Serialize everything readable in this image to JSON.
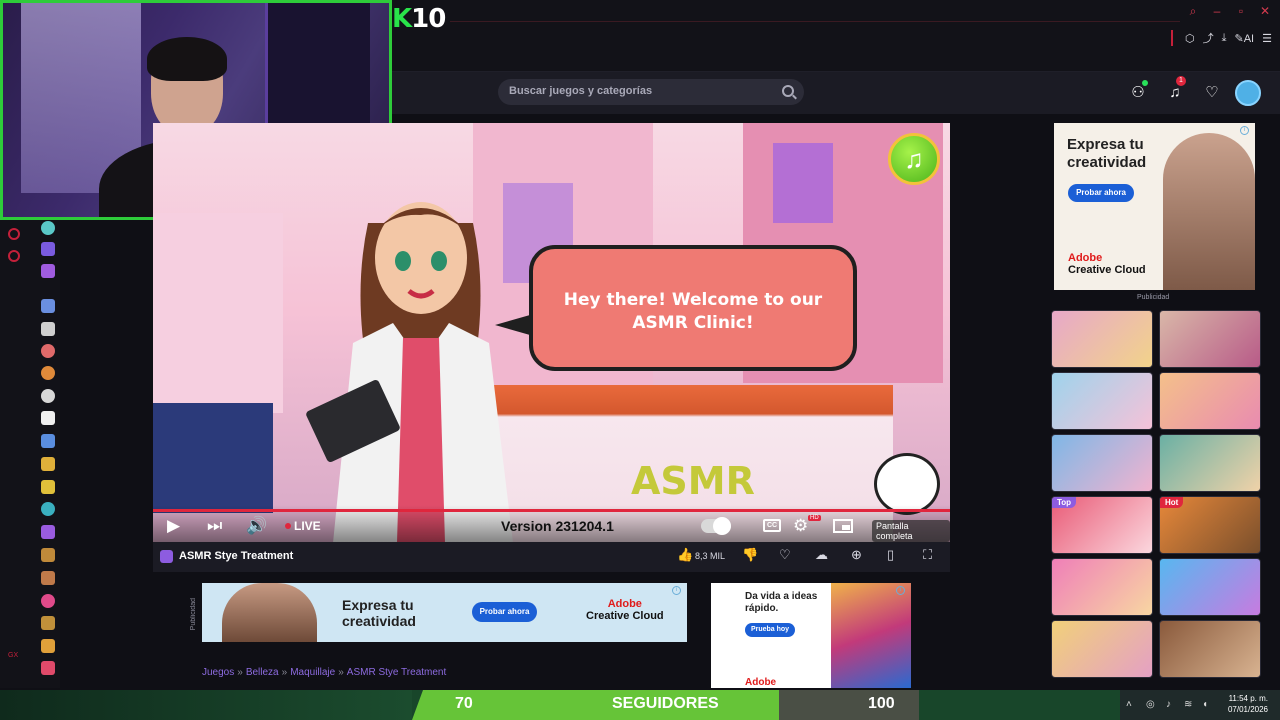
{
  "stream_overlay": {
    "logo_k": "K",
    "logo_num": "10"
  },
  "search": {
    "placeholder": "Buscar juegos y categorías"
  },
  "header": {
    "notifications_count": "1"
  },
  "game": {
    "speech_text": "Hey there! Welcome to our ASMR Clinic!",
    "title_logo": "ASMR",
    "live_label": "LIVE",
    "version": "Version 231204.1",
    "fullscreen_tooltip": "Pantalla completa",
    "name": "ASMR Stye Treatment",
    "likes": "8,3 MIL",
    "cc_label": "CC",
    "hd_label": "HD"
  },
  "ad_top": {
    "headline": "Expresa tu creatividad",
    "button": "Probar ahora",
    "brand_line1": "Adobe",
    "brand_line2": "Creative Cloud",
    "label": "Publicidad"
  },
  "ad_bottom": {
    "side_label": "Publicidad",
    "headline": "Expresa tu creatividad",
    "button": "Probar ahora",
    "brand_line1": "Adobe",
    "brand_line2": "Creative Cloud"
  },
  "ad_small": {
    "headline": "Da vida a ideas rápido.",
    "button": "Prueba hoy",
    "brand": "Adobe"
  },
  "thumbnails": [
    {
      "badge": "",
      "colors": [
        "#e7a8c9",
        "#f2d38a"
      ]
    },
    {
      "badge": "",
      "colors": [
        "#d9b7a8",
        "#b85b88"
      ]
    },
    {
      "badge": "",
      "colors": [
        "#9fd3ec",
        "#f5c2d8"
      ]
    },
    {
      "badge": "",
      "colors": [
        "#f4c08a",
        "#e98bb0"
      ]
    },
    {
      "badge": "",
      "colors": [
        "#7fb7e6",
        "#f1b3cf"
      ]
    },
    {
      "badge": "",
      "colors": [
        "#6ab0a4",
        "#f0d2a8"
      ]
    },
    {
      "badge": "Top",
      "colors": [
        "#e95b77",
        "#fbd7de"
      ]
    },
    {
      "badge": "Hot",
      "colors": [
        "#e7883a",
        "#7a4f2c"
      ]
    },
    {
      "badge": "",
      "colors": [
        "#ef7fb8",
        "#f8d6a2"
      ]
    },
    {
      "badge": "",
      "colors": [
        "#58b7f0",
        "#c77be0"
      ]
    },
    {
      "badge": "",
      "colors": [
        "#f1d07a",
        "#e4a0c4"
      ]
    },
    {
      "badge": "",
      "colors": [
        "#8a5a3c",
        "#d8b391"
      ]
    }
  ],
  "breadcrumbs": [
    "Juegos",
    "Belleza",
    "Maquillaje",
    "ASMR Stye Treatment"
  ],
  "breadcrumb_sep": "»",
  "rail_label": "GX",
  "followers_goal": {
    "current": "70",
    "label": "SEGUIDORES",
    "target": "100"
  },
  "taskbar": {
    "time": "11:54 p. m.",
    "date": "07/01/2026"
  },
  "colors": {
    "accent_red": "#e0263d",
    "webcam_border": "#2ecc3a",
    "goal_green": "#66c438",
    "link_purple": "#8d6be0"
  }
}
